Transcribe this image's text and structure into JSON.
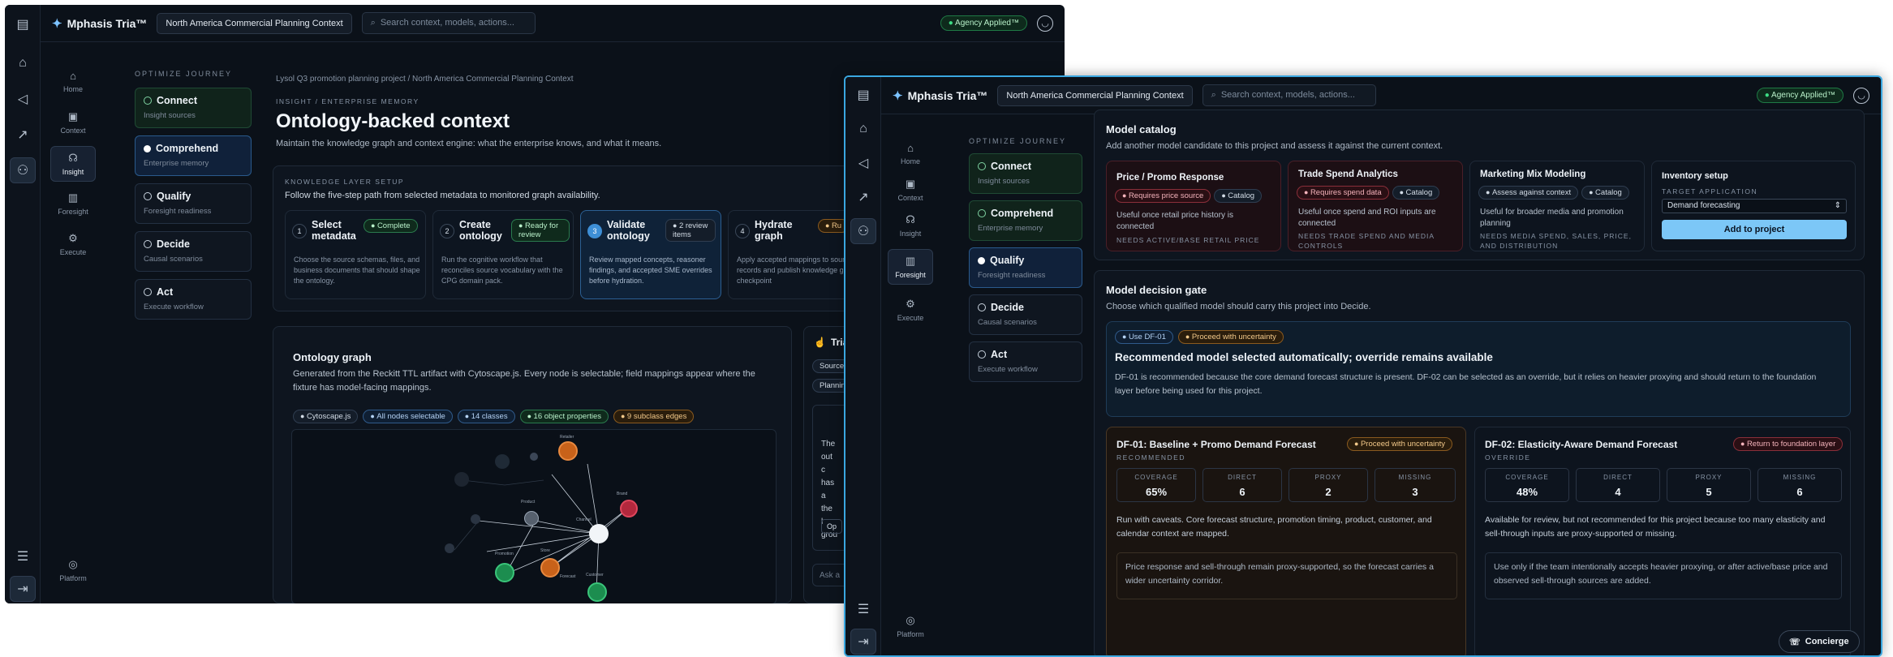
{
  "brand": "Mphasis Tria™",
  "context_chip": "North America Commercial Planning Context",
  "search_placeholder": "Search context, models, actions...",
  "agency": "Agency Applied™",
  "nav": {
    "home": "Home",
    "context": "Context",
    "insight": "Insight",
    "foresight": "Foresight",
    "execute": "Execute",
    "platform": "Platform"
  },
  "journey": {
    "heading": "OPTIMIZE JOURNEY",
    "steps": [
      {
        "title": "Connect",
        "sub": "Insight sources"
      },
      {
        "title": "Comprehend",
        "sub": "Enterprise memory"
      },
      {
        "title": "Qualify",
        "sub": "Foresight readiness"
      },
      {
        "title": "Decide",
        "sub": "Causal scenarios"
      },
      {
        "title": "Act",
        "sub": "Execute workflow"
      }
    ]
  },
  "win1": {
    "breadcrumb": "Lysol Q3 promotion planning project  /  North America Commercial Planning Context",
    "eyebrow": "INSIGHT / ENTERPRISE MEMORY",
    "title": "Ontology-backed context",
    "subtitle": "Maintain the knowledge graph and context engine: what the enterprise knows, and what it means.",
    "setup_eyebrow": "KNOWLEDGE LAYER SETUP",
    "setup_text": "Follow the five-step path from selected metadata to monitored graph availability.",
    "setup_steps": [
      {
        "num": "1",
        "title": "Select metadata",
        "badge": "Complete",
        "desc": "Choose the source schemas, files, and business documents that should shape the ontology."
      },
      {
        "num": "2",
        "title": "Create ontology",
        "badge": "Ready for review",
        "desc": "Run the cognitive workflow that reconciles source vocabulary with the CPG domain pack."
      },
      {
        "num": "3",
        "title": "Validate ontology",
        "badge": "2 review items",
        "desc": "Review mapped concepts, reasoner findings, and accepted SME overrides before hydration."
      },
      {
        "num": "4",
        "title": "Hydrate graph",
        "badge": "Ru",
        "desc": "Apply accepted mappings to source records and publish knowledge graph checkpoint"
      }
    ],
    "graph_title": "Ontology graph",
    "graph_desc": "Generated from the Reckitt TTL artifact with Cytoscape.js. Every node is selectable; field mappings appear where the fixture has model-facing mappings.",
    "graph_pills": [
      "Cytoscape.js",
      "All nodes selectable",
      "14 classes",
      "16 object properties",
      "9 subclass edges"
    ],
    "node_labels": [
      "Retailer",
      "Product",
      "Promotion",
      "Store",
      "Channel",
      "Brand",
      "Customer",
      "Forecast"
    ],
    "side_panel": {
      "title": "Tria",
      "chips": [
        "Source",
        "Plannin"
      ],
      "text": "The out c has a the l grou",
      "button": "Op",
      "input": "Ask a"
    }
  },
  "win2": {
    "catalog_title": "Model catalog",
    "catalog_desc": "Add another model candidate to this project and assess it against the current context.",
    "catalog": [
      {
        "title": "Price / Promo Response",
        "badges": [
          "Requires price source",
          "Catalog"
        ],
        "desc": "Useful once retail price history is connected",
        "needs": "NEEDS ACTIVE/BASE RETAIL PRICE"
      },
      {
        "title": "Trade Spend Analytics",
        "badges": [
          "Requires spend data",
          "Catalog"
        ],
        "desc": "Useful once spend and ROI inputs are connected",
        "needs": "NEEDS TRADE SPEND AND MEDIA CONTROLS"
      },
      {
        "title": "Marketing Mix Modeling",
        "badges": [
          "Assess against context",
          "Catalog"
        ],
        "desc": "Useful for broader media and promotion planning",
        "needs": "NEEDS MEDIA SPEND, SALES, PRICE, AND DISTRIBUTION"
      }
    ],
    "inventory": {
      "title": "Inventory setup",
      "label": "TARGET APPLICATION",
      "select": "Demand forecasting",
      "button": "Add to project"
    },
    "gate_title": "Model decision gate",
    "gate_desc": "Choose which qualified model should carry this project into Decide.",
    "reco": {
      "pills": [
        "Use DF-01",
        "Proceed with uncertainty"
      ],
      "title": "Recommended model selected automatically; override remains available",
      "desc": "DF-01 is recommended because the core demand forecast structure is present. DF-02 can be selected as an override, but it relies on heavier proxying and should return to the foundation layer before being used for this project."
    },
    "models": [
      {
        "title": "DF-01: Baseline + Promo Demand Forecast",
        "badge": "Proceed with uncertainty",
        "tag": "RECOMMENDED",
        "metrics": [
          {
            "l": "COVERAGE",
            "v": "65%"
          },
          {
            "l": "DIRECT",
            "v": "6"
          },
          {
            "l": "PROXY",
            "v": "2"
          },
          {
            "l": "MISSING",
            "v": "3"
          }
        ],
        "desc": "Run with caveats. Core forecast structure, promotion timing, product, customer, and calendar context are mapped.",
        "note": "Price response and sell-through remain proxy-supported, so the forecast carries a wider uncertainty corridor."
      },
      {
        "title": "DF-02: Elasticity-Aware Demand Forecast",
        "badge": "Return to foundation layer",
        "tag": "OVERRIDE",
        "metrics": [
          {
            "l": "COVERAGE",
            "v": "48%"
          },
          {
            "l": "DIRECT",
            "v": "4"
          },
          {
            "l": "PROXY",
            "v": "5"
          },
          {
            "l": "MISSING",
            "v": "6"
          }
        ],
        "desc": "Available for review, but not recommended for this project because too many elasticity and sell-through inputs are proxy-supported or missing.",
        "note": "Use only if the team intentionally accepts heavier proxying, or after active/base price and observed sell-through sources are added."
      }
    ],
    "concierge": "Concierge"
  }
}
